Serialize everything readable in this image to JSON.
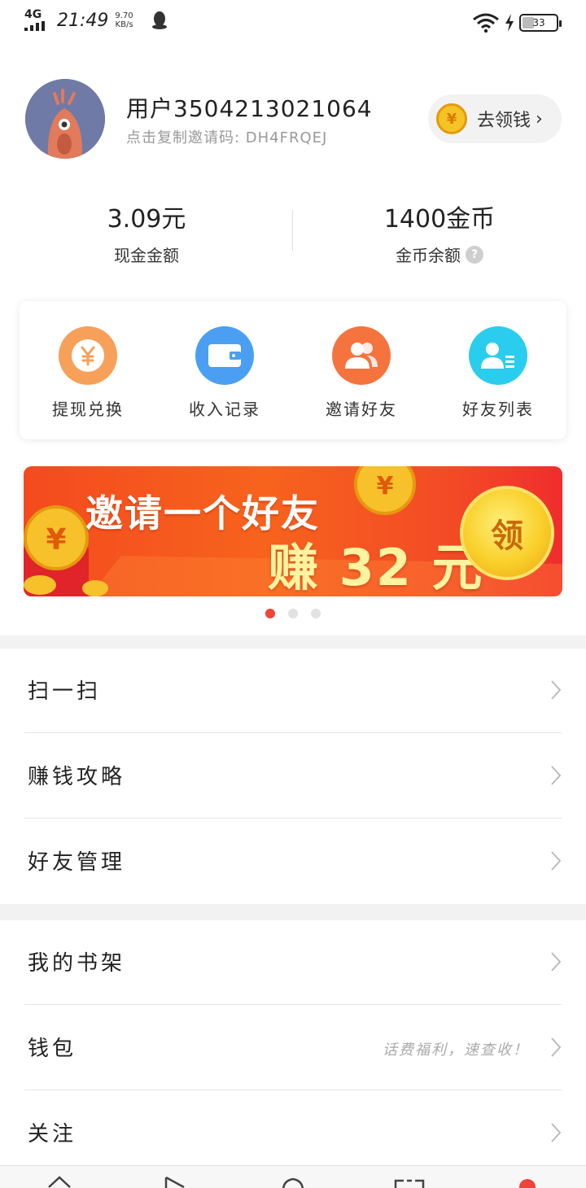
{
  "status_bar": {
    "network": "4G",
    "time": "21:49",
    "speed_value": "9.70",
    "speed_unit": "KB/s",
    "battery": "33",
    "icons": [
      "signal-icon",
      "qq-icon",
      "wifi-icon",
      "charging-icon",
      "battery-icon"
    ]
  },
  "profile": {
    "username": "用户3504213021064",
    "invite_code": "点击复制邀请码: DH4FRQEJ",
    "get_cash_label": "去领钱"
  },
  "balances": {
    "cash_value": "3.09元",
    "cash_label": "现金金额",
    "coin_value": "1400金币",
    "coin_label": "金币余额"
  },
  "actions": [
    {
      "label": "提现兑换",
      "icon": "yuan-icon",
      "color": "#f6a05a"
    },
    {
      "label": "收入记录",
      "icon": "wallet-icon",
      "color": "#4a9ff2"
    },
    {
      "label": "邀请好友",
      "icon": "friends-icon",
      "color": "#f5743e"
    },
    {
      "label": "好友列表",
      "icon": "contact-list-icon",
      "color": "#2bcdee"
    }
  ],
  "banner": {
    "line1": "邀请一个好友",
    "line2": "赚 32 元",
    "button": "领",
    "page_count": 3,
    "active_page": 1
  },
  "menu": {
    "scan": "扫一扫",
    "earn_tips": "赚钱攻略",
    "friend_manage": "好友管理",
    "bookshelf": "我的书架",
    "wallet": "钱包",
    "wallet_hint": "话费福利，速查收！",
    "follow": "关注"
  },
  "colors": {
    "accent_red": "#f0433a",
    "banner_orange": "#f7631d",
    "coin_gold": "#f6c325"
  }
}
